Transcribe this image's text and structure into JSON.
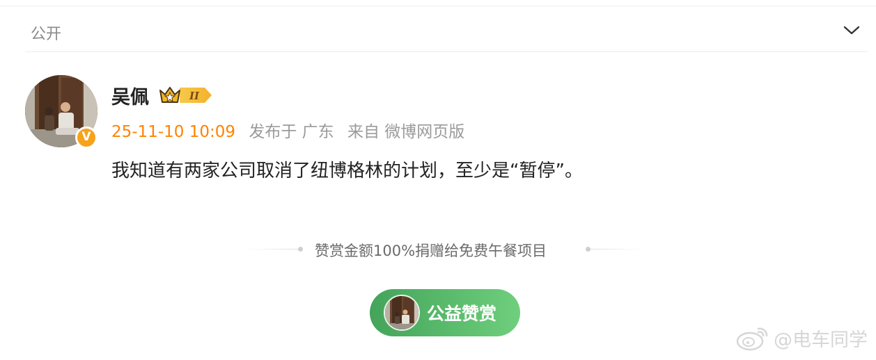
{
  "visibility": {
    "label": "公开",
    "chevron_icon": "chevron-down-icon"
  },
  "post": {
    "author": {
      "name": "吴佩",
      "verified_icon": "verified-v-icon",
      "member_icon": "crown-level-badge-icon",
      "member_level": "II"
    },
    "time": "25-11-10 10:09",
    "location": "发布于 广东",
    "source": "来自 微博网页版",
    "text": "我知道有两家公司取消了纽博格林的计划，至少是“暂停”。"
  },
  "reward": {
    "note": "赞赏金额100%捐赠给免费午餐项目",
    "button_label": "公益赞赏"
  },
  "watermark": {
    "text": "@电车同学",
    "icon": "weibo-logo-icon"
  },
  "colors": {
    "time": "#ff8200",
    "reward_button": "#4caf60",
    "verified": "#f7a21b"
  }
}
